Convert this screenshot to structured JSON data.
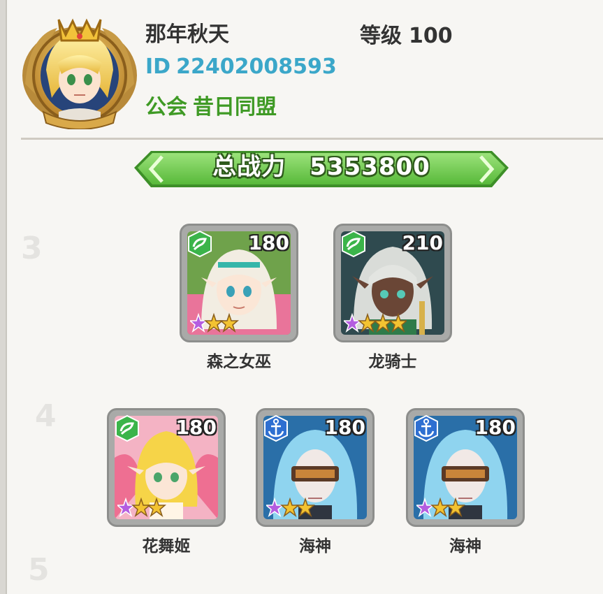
{
  "player": {
    "name": "那年秋天",
    "level_label": "等级",
    "level_value": "100",
    "id_label": "ID",
    "id_value": "22402008593",
    "guild_label": "公会",
    "guild_value": "昔日同盟"
  },
  "power": {
    "label": "总战力",
    "value": "5353800"
  },
  "heroes": [
    {
      "name": "森之女巫",
      "level": "180",
      "faction": "forest-icon",
      "stars": 3,
      "rainbow_stars": 1
    },
    {
      "name": "龙骑士",
      "level": "210",
      "faction": "forest-icon",
      "stars": 4,
      "rainbow_stars": 1
    },
    {
      "name": "花舞姬",
      "level": "180",
      "faction": "forest-icon",
      "stars": 3,
      "rainbow_stars": 1
    },
    {
      "name": "海神",
      "level": "180",
      "faction": "anchor-icon",
      "stars": 3,
      "rainbow_stars": 1
    },
    {
      "name": "海神",
      "level": "180",
      "faction": "anchor-icon",
      "stars": 3,
      "rainbow_stars": 1
    }
  ],
  "colors": {
    "id": "#3ba7c9",
    "guild": "#3f9a25",
    "power_bar": "#7fd35a",
    "forest_badge": "#3bb44a",
    "anchor_badge": "#2e6fd1"
  }
}
